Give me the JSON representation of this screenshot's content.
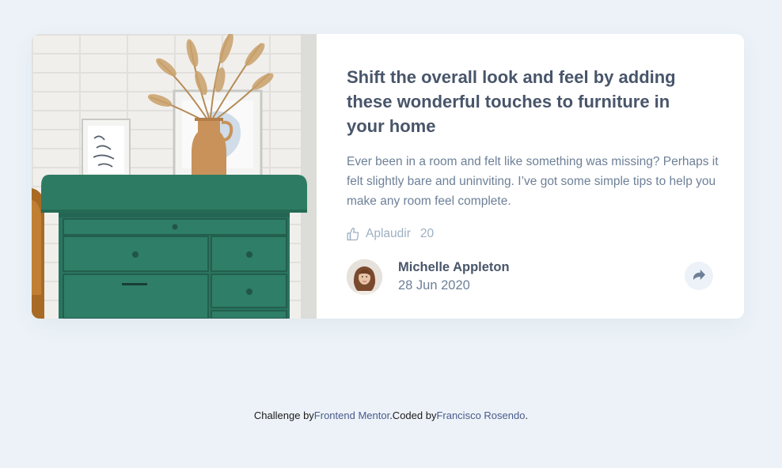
{
  "article": {
    "title": "Shift the overall look and feel by adding these wonderful touches to furniture in your home",
    "description": "Ever been in a room and felt like something was missing? Perhaps it felt slightly bare and uninviting. I’ve got some simple tips to help you make any room feel complete.",
    "image_icon": "drawers-photo",
    "applause": {
      "label": "Aplaudir",
      "count": "20",
      "icon": "thumbs-up-icon"
    },
    "author": {
      "name": "Michelle Appleton",
      "date": "28 Jun 2020",
      "avatar_icon": "avatar"
    },
    "share_icon": "share-icon"
  },
  "attribution": {
    "prefix": "Challenge by",
    "challenge_link": "Frontend Mentor",
    "middle": ".Coded by",
    "author_link": "Francisco Rosendo",
    "suffix": "."
  },
  "colors": {
    "background": "#ecf2f8",
    "card": "#ffffff",
    "title": "#48556a",
    "text": "#6e8098",
    "muted": "#9eafc2",
    "dresser_green": "#2e7b63",
    "link": "#4a5a8a"
  }
}
